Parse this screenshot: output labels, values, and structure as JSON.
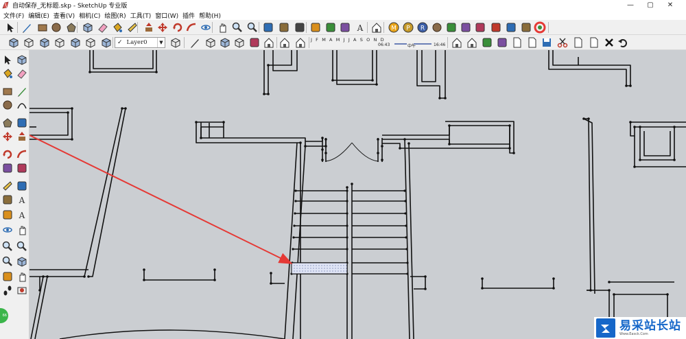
{
  "window": {
    "title": "自动保存_无标题.skp - SketchUp 专业版",
    "minimize": "—",
    "maximize": "▢",
    "close": "✕"
  },
  "menu": [
    "文件(F)",
    "编辑(E)",
    "查看(V)",
    "相机(C)",
    "绘图(R)",
    "工具(T)",
    "窗口(W)",
    "插件",
    "帮助(H)"
  ],
  "layer": {
    "checked": "✓",
    "name": "Layer0",
    "arrow": "▼"
  },
  "shadow": {
    "months": "J F M A M J J A S O N D",
    "time_start": "06:43",
    "time_mid": "中午",
    "time_end": "16:46"
  },
  "badge": {
    "text": "66"
  },
  "watermark": {
    "text": "易采站长站",
    "url": "Www.Easck.Com"
  },
  "colors": {
    "viewport": "#cbced2",
    "wall": "#111111",
    "arrow": "#e53935",
    "watermark_blue": "#1667c9",
    "hatch_fill": "#dfe4f5"
  },
  "icons": {
    "row1": [
      "select-icon",
      "pencil-icon",
      "rectangle-icon",
      "circle-icon",
      "polygon-icon",
      "make-component-icon",
      "eraser-icon",
      "paint-bucket-icon",
      "tape-measure-icon",
      "push-pull-icon",
      "move-icon",
      "rotate-icon",
      "follow-me-icon",
      "orbit-icon",
      "pan-icon",
      "zoom-icon",
      "zoom-extents-icon",
      "add-location-icon",
      "toggle-terrain-icon",
      "get-models-icon",
      "share-model-icon",
      "google-earth-icon",
      "ruby-console-icon",
      "photo-texture-icon",
      "warehouse-icon",
      "m-plugin-icon",
      "p-plugin-icon",
      "r-plugin-icon",
      "info-plugin-icon",
      "sun-plugin-icon",
      "plugin-a-icon",
      "plugin-b-icon",
      "plugin-c-icon",
      "plugin-d-icon",
      "plugin-e-icon",
      "color-wheel-icon"
    ],
    "row2": [
      "iso-view-icon",
      "top-view-icon",
      "front-view-icon",
      "right-view-icon",
      "back-view-icon",
      "left-view-icon",
      "xray-icon",
      "wireframe-icon",
      "hidden-line-icon",
      "shaded-icon",
      "textured-icon",
      "monochrome-icon",
      "layer-manager-icon",
      "house-icon-1",
      "house-icon-2",
      "house-icon-3",
      "house-icon-4",
      "house-icon-5",
      "shadow-toggle-icon",
      "shadow-settings-icon",
      "new-file-icon",
      "open-file-icon",
      "save-icon",
      "cut-icon",
      "copy-icon",
      "paste-icon",
      "delete-icon",
      "undo-icon",
      "redo-icon",
      "print-icon",
      "model-info-icon"
    ],
    "left": [
      "select-icon",
      "component-icon",
      "paint-bucket-icon",
      "eraser-icon",
      "rectangle-icon",
      "line-icon",
      "circle-icon",
      "arc-icon",
      "polygon-icon",
      "freehand-icon",
      "move-icon",
      "push-pull-icon",
      "rotate-icon",
      "follow-me-icon",
      "scale-icon",
      "offset-icon",
      "tape-measure-icon",
      "dimension-icon",
      "protractor-icon",
      "text-icon",
      "axes-icon",
      "3d-text-icon",
      "orbit-icon",
      "pan-icon",
      "zoom-icon",
      "zoom-window-icon",
      "zoom-extents-icon",
      "previous-view-icon",
      "position-camera-icon",
      "look-around-icon",
      "walk-icon",
      "section-plane-icon"
    ]
  }
}
